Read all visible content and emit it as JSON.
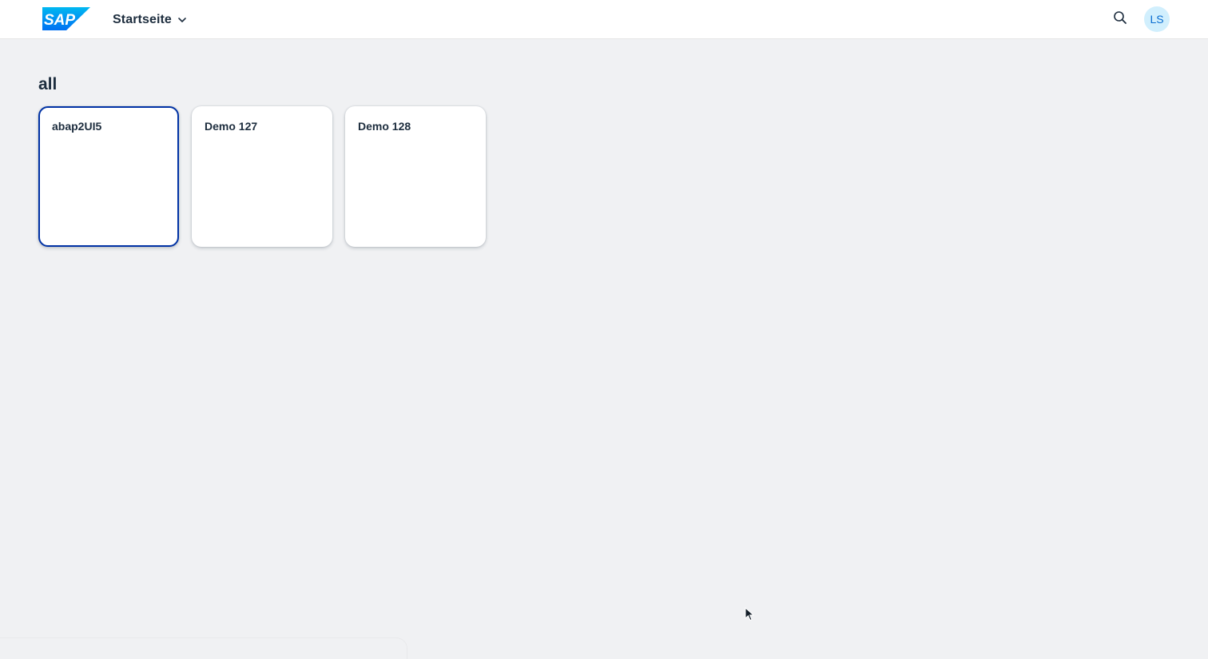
{
  "header": {
    "logo_text": "SAP",
    "title": "Startseite",
    "avatar_initials": "LS",
    "brand_colors": [
      "#0070f2",
      "#00b8f1"
    ]
  },
  "section": {
    "title": "all"
  },
  "tiles": [
    {
      "title": "abap2UI5",
      "focused": true
    },
    {
      "title": "Demo 127",
      "focused": false
    },
    {
      "title": "Demo 128",
      "focused": false
    }
  ],
  "icons": {
    "title_menu": "chevron-down-icon",
    "search": "search-icon",
    "pointer": "mouse-pointer-icon"
  },
  "colors": {
    "background": "#f0f1f3",
    "header": "#ffffff",
    "focus_border": "#0032a5",
    "avatar_bg": "#d1effd",
    "avatar_text": "#0a6ed1"
  }
}
